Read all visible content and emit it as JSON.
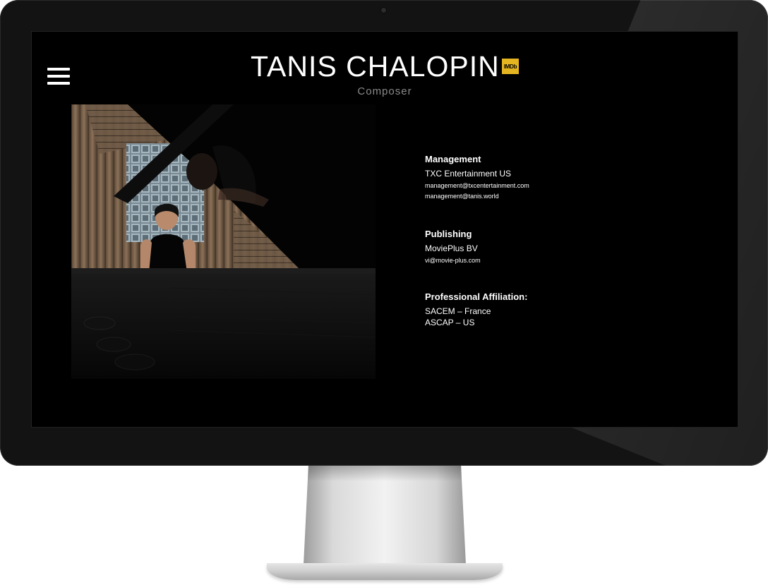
{
  "site": {
    "title": "TANIS CHALOPIN",
    "imdb_label": "IMDb",
    "subtitle": "Composer"
  },
  "contacts": {
    "management": {
      "heading": "Management",
      "company": "TXC Entertainment US",
      "emails": [
        "management@txcentertainment.com",
        "management@tanis.world"
      ]
    },
    "publishing": {
      "heading": "Publishing",
      "company": "MoviePlus BV",
      "email": "vi@movie-plus.com"
    },
    "affiliation": {
      "heading": "Professional Affiliation:",
      "items": [
        "SACEM – France",
        "ASCAP – US"
      ]
    }
  },
  "icons": {
    "menu": "hamburger-menu-icon",
    "imdb": "imdb-badge-icon"
  },
  "colors": {
    "background": "#000000",
    "text": "#ffffff",
    "subtitle": "#8a8a8a",
    "imdb_accent": "#e5b521"
  }
}
